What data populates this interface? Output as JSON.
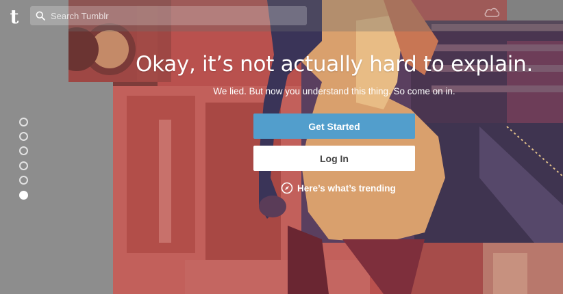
{
  "header": {
    "logo_letter": "t",
    "search": {
      "placeholder": "Search Tumblr"
    }
  },
  "hero": {
    "headline": "Okay, it’s not actually hard to explain.",
    "subtitle": "We lied. But now you understand this thing. So come on in.",
    "get_started_label": "Get Started",
    "login_label": "Log In",
    "trending_label": "Here’s what’s trending"
  },
  "pagination": {
    "total": 6,
    "active_index": 5
  },
  "colors": {
    "accent_blue": "#529ecc",
    "overlay_red": "#c0504d",
    "overlay_gray": "#8d8d8d"
  },
  "icons": {
    "search": "search-icon",
    "trending": "compass-icon",
    "top_right": "cloud-icon"
  }
}
